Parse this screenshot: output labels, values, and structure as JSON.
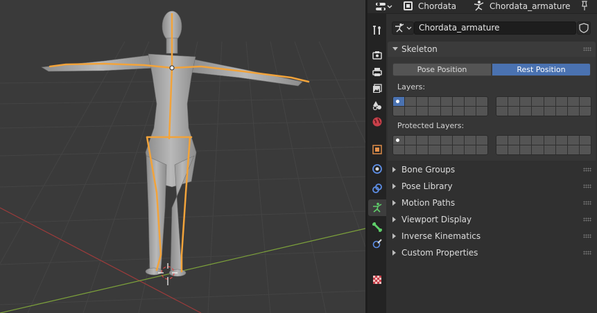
{
  "header": {
    "object_name": "Chordata",
    "data_name": "Chordata_armature",
    "icons": [
      "editor-type-icon",
      "object-icon",
      "armature-icon",
      "pin-icon"
    ]
  },
  "datablock": {
    "name": "Chordata_armature",
    "icons": [
      "armature-data-icon",
      "fake-user-shield-icon"
    ]
  },
  "tabs": [
    {
      "name": "tool",
      "icon": "wrench-screwdriver-icon"
    },
    {
      "name": "render",
      "icon": "camera-back-icon"
    },
    {
      "name": "output",
      "icon": "printer-icon"
    },
    {
      "name": "view-layer",
      "icon": "image-stack-icon"
    },
    {
      "name": "scene",
      "icon": "shapes-icon"
    },
    {
      "name": "world",
      "icon": "globe-icon"
    },
    {
      "name": "object",
      "icon": "orange-square-icon"
    },
    {
      "name": "physics",
      "icon": "physics-circle-icon"
    },
    {
      "name": "constraints",
      "icon": "constraint-icon"
    },
    {
      "name": "armature-data",
      "icon": "running-figure-icon",
      "active": true
    },
    {
      "name": "bone",
      "icon": "bone-icon"
    },
    {
      "name": "bone-constraints",
      "icon": "bone-constraint-icon"
    },
    {
      "name": "texture",
      "icon": "checkerboard-icon"
    }
  ],
  "skeleton": {
    "title": "Skeleton",
    "pose_position_label": "Pose Position",
    "rest_position_label": "Rest Position",
    "active_position": "Rest Position",
    "layers_label": "Layers:",
    "protected_layers_label": "Protected Layers:",
    "active_layer_index": 0
  },
  "panels": [
    {
      "title": "Bone Groups"
    },
    {
      "title": "Pose Library"
    },
    {
      "title": "Motion Paths"
    },
    {
      "title": "Viewport Display"
    },
    {
      "title": "Inverse Kinematics"
    },
    {
      "title": "Custom Properties"
    }
  ],
  "colors": {
    "accent": "#4a72b1",
    "bone": "#f2a33a",
    "x_axis": "#9e3b3b",
    "y_axis": "#7da23a"
  }
}
